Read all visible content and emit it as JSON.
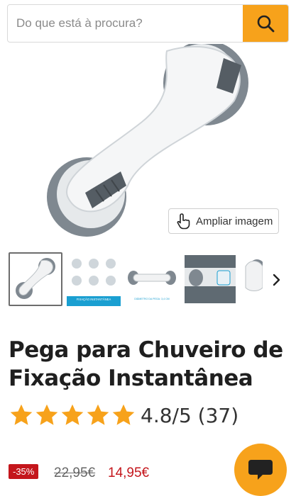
{
  "search": {
    "placeholder": "Do que está à procura?"
  },
  "icons": {
    "search": "search-icon",
    "zoom": "hand-pointer-icon",
    "next": "chevron-right-icon",
    "chat": "chat-bubble-icon"
  },
  "zoom_button": {
    "label": "Ampliar imagem"
  },
  "thumbnails": [
    {
      "name": "thumb-1",
      "caption": ""
    },
    {
      "name": "thumb-2",
      "caption": "FIXAÇÃO INSTANTÂNEA"
    },
    {
      "name": "thumb-3",
      "caption": "DIÂMETRO DA PEGA: 3,4 CM"
    },
    {
      "name": "thumb-4",
      "caption": ""
    },
    {
      "name": "thumb-5",
      "caption": ""
    }
  ],
  "product": {
    "title_line1": "Pega para Chuveiro de",
    "title_line2": "Fixação Instantânea",
    "rating_text": "4.8/5 (37)",
    "rating_value": 4.8,
    "rating_max": 5,
    "review_count": 37
  },
  "price": {
    "discount": "-35%",
    "old": "22,95€",
    "new": "14,95€"
  },
  "colors": {
    "accent": "#f7a21b",
    "sale": "#c4161c",
    "star": "#f7a21b"
  }
}
